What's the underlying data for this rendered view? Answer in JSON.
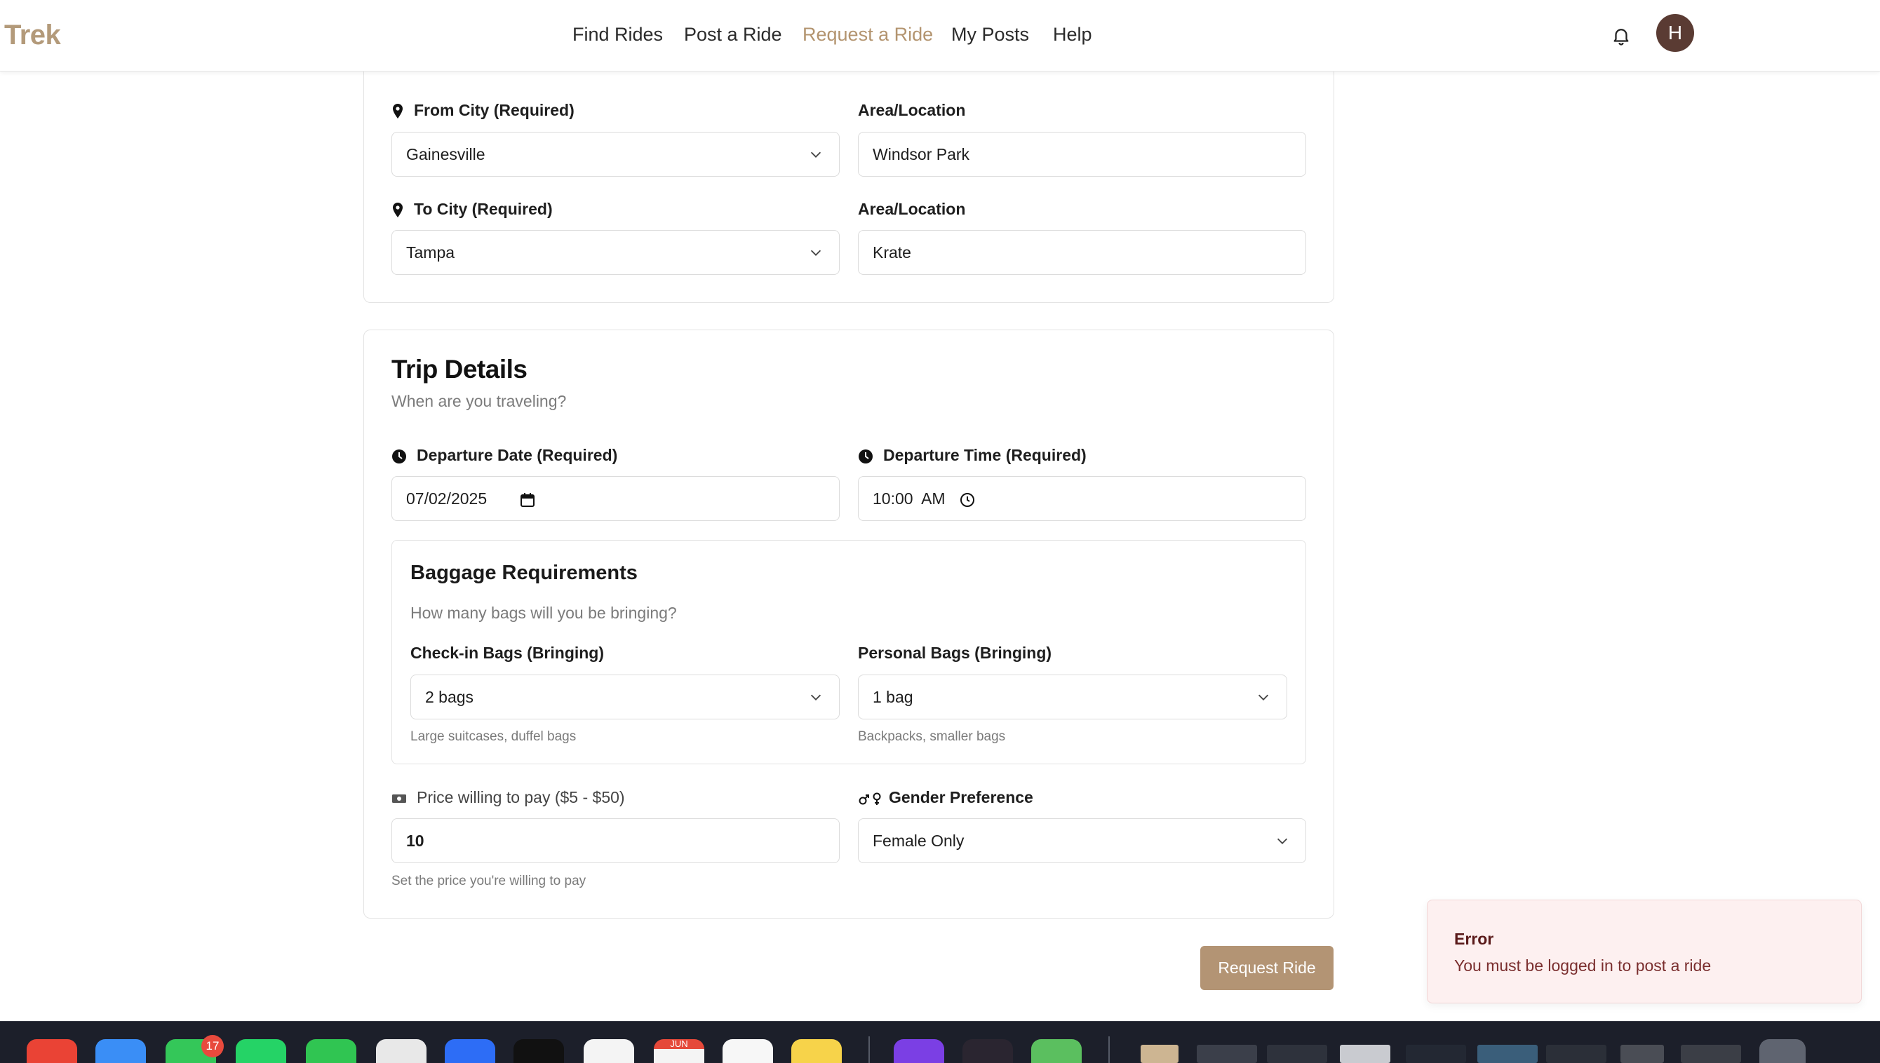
{
  "header": {
    "logo": "Trek",
    "nav": [
      "Find Rides",
      "Post a Ride",
      "Request a Ride",
      "My Posts",
      "Help"
    ],
    "active_nav": "Request a Ride",
    "avatar_initial": "H"
  },
  "route": {
    "from_label": "From City (Required)",
    "from_value": "Gainesville",
    "from_area_label": "Area/Location",
    "from_area_value": "Windsor Park",
    "to_label": "To City (Required)",
    "to_value": "Tampa",
    "to_area_label": "Area/Location",
    "to_area_value": "Krate"
  },
  "trip": {
    "title": "Trip Details",
    "subtitle": "When are you traveling?",
    "date_label": "Departure Date (Required)",
    "date_value": "07/02/2025",
    "time_label": "Departure Time (Required)",
    "time_value": "10:00  AM"
  },
  "baggage": {
    "title": "Baggage Requirements",
    "subtitle": "How many bags will you be bringing?",
    "checkin_label": "Check-in Bags (Bringing)",
    "checkin_value": "2 bags",
    "checkin_hint": "Large suitcases, duffel bags",
    "personal_label": "Personal Bags (Bringing)",
    "personal_value": "1 bag",
    "personal_hint": "Backpacks, smaller bags"
  },
  "price": {
    "label": "Price willing to pay ($5 - $50)",
    "value": "10",
    "hint": "Set the price you're willing to pay"
  },
  "gender": {
    "label": "Gender Preference",
    "value": "Female Only"
  },
  "submit_label": "Request Ride",
  "toast": {
    "title": "Error",
    "message": "You must be logged in to post a ride"
  },
  "dock": {
    "messages_badge": "17",
    "calendar_month": "JUN"
  },
  "colors": {
    "accent": "#b3946f",
    "button": "#b39474",
    "avatar": "#5a3b33",
    "error_bg": "#fdf0f0",
    "error_text": "#7a2e2e"
  },
  "icons": [
    "bell-icon",
    "map-pin-icon",
    "clock-icon",
    "calendar-icon",
    "chevron-down-icon",
    "money-icon",
    "gender-icon"
  ]
}
